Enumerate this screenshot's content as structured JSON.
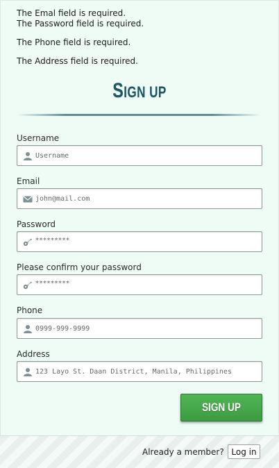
{
  "errors": [
    "The Emal field is required.",
    "The Password field is required.",
    "The Phone field is required.",
    "The Address field is required."
  ],
  "title": {
    "first": "S",
    "rest": "IGN UP"
  },
  "fields": {
    "username": {
      "label": "Username",
      "placeholder": "Username",
      "icon": "user-icon"
    },
    "email": {
      "label": "Email",
      "placeholder": "john@mail.com",
      "icon": "envelope-icon"
    },
    "password": {
      "label": "Password",
      "value": "*********",
      "icon": "key-icon"
    },
    "confirm": {
      "label": "Please confirm your password",
      "value": "*********",
      "icon": "key-icon"
    },
    "phone": {
      "label": "Phone",
      "placeholder": "0999-999-9999",
      "icon": "user-icon"
    },
    "address": {
      "label": "Address",
      "placeholder": "123 Layo St. Daan District, Manila, Philippines",
      "icon": "user-icon"
    }
  },
  "signup_button": "SIGN UP",
  "footer": {
    "member_text": "Already a member?",
    "login_label": "Log in"
  },
  "colors": {
    "background": "#effcf6",
    "title": "#1e5662",
    "button": "#45a84a"
  }
}
